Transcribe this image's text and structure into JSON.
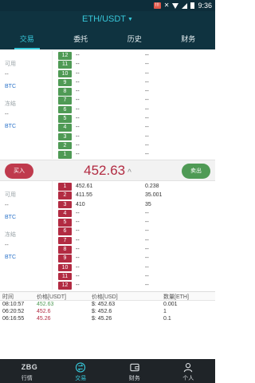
{
  "status_bar": {
    "time": "9:36",
    "badge": "!!!"
  },
  "header": {
    "pair": "ETH/USDT",
    "tabs": [
      {
        "label": "交易",
        "active": true
      },
      {
        "label": "委托",
        "active": false
      },
      {
        "label": "历史",
        "active": false
      },
      {
        "label": "财务",
        "active": false
      }
    ]
  },
  "sell_side": {
    "available_label": "可用",
    "available_value": "--",
    "available_unit": "BTC",
    "frozen_label": "冻结",
    "frozen_value": "--",
    "frozen_unit": "BTC"
  },
  "sell_orders": [
    {
      "no": "12",
      "price": "--",
      "amount": "--"
    },
    {
      "no": "11",
      "price": "--",
      "amount": "--"
    },
    {
      "no": "10",
      "price": "--",
      "amount": "--"
    },
    {
      "no": "9",
      "price": "--",
      "amount": "--"
    },
    {
      "no": "8",
      "price": "--",
      "amount": "--"
    },
    {
      "no": "7",
      "price": "--",
      "amount": "--"
    },
    {
      "no": "6",
      "price": "--",
      "amount": "--"
    },
    {
      "no": "5",
      "price": "--",
      "amount": "--"
    },
    {
      "no": "4",
      "price": "--",
      "amount": "--"
    },
    {
      "no": "3",
      "price": "--",
      "amount": "--"
    },
    {
      "no": "2",
      "price": "--",
      "amount": "--"
    },
    {
      "no": "1",
      "price": "--",
      "amount": "--"
    }
  ],
  "mid": {
    "buy_label": "买入",
    "last_price": "452.63",
    "sell_label": "卖出"
  },
  "buy_side": {
    "available_label": "可用",
    "available_value": "--",
    "available_unit": "BTC",
    "frozen_label": "冻结",
    "frozen_value": "--",
    "frozen_unit": "BTC"
  },
  "buy_orders": [
    {
      "no": "1",
      "price": "452.61",
      "amount": "0.238"
    },
    {
      "no": "2",
      "price": "411.55",
      "amount": "35.001"
    },
    {
      "no": "3",
      "price": "410",
      "amount": "35"
    },
    {
      "no": "4",
      "price": "--",
      "amount": "--"
    },
    {
      "no": "5",
      "price": "--",
      "amount": "--"
    },
    {
      "no": "6",
      "price": "--",
      "amount": "--"
    },
    {
      "no": "7",
      "price": "--",
      "amount": "--"
    },
    {
      "no": "8",
      "price": "--",
      "amount": "--"
    },
    {
      "no": "9",
      "price": "--",
      "amount": "--"
    },
    {
      "no": "10",
      "price": "--",
      "amount": "--"
    },
    {
      "no": "11",
      "price": "--",
      "amount": "--"
    },
    {
      "no": "12",
      "price": "--",
      "amount": "--"
    }
  ],
  "trades": {
    "headers": [
      "时间",
      "价格[USDT]",
      "价格[USD]",
      "数量[ETH]"
    ],
    "rows": [
      {
        "time": "08:10:57",
        "price_usdt": "452.63",
        "price_usd": "$: 452.63",
        "qty": "0.001",
        "dir": "green"
      },
      {
        "time": "06:20:52",
        "price_usdt": "452.6",
        "price_usd": "$: 452.6",
        "qty": "1",
        "dir": "red"
      },
      {
        "time": "06:16:55",
        "price_usdt": "45.26",
        "price_usd": "$: 45.26",
        "qty": "0.1",
        "dir": "red"
      }
    ]
  },
  "bottom_nav": [
    {
      "label": "行情",
      "icon": "zbg-logo",
      "logo_text": "ZBG",
      "active": false
    },
    {
      "label": "交易",
      "icon": "trade-icon",
      "active": true
    },
    {
      "label": "财务",
      "icon": "wallet-icon",
      "active": false
    },
    {
      "label": "个人",
      "icon": "person-icon",
      "active": false
    }
  ],
  "colors": {
    "header": "#0f3340",
    "accent": "#37c7d9",
    "sell": "#b22b42",
    "buy": "#4f9a55"
  }
}
